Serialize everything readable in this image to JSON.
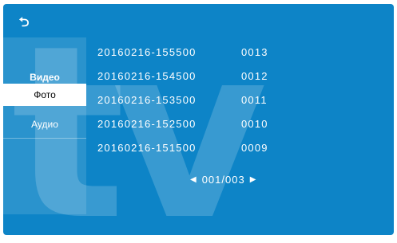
{
  "watermark": "tv",
  "back_icon": "back-arrow-icon",
  "sidebar": {
    "items": [
      {
        "label": "Видео",
        "selected": false
      },
      {
        "label": "Фото",
        "selected": true
      },
      {
        "label": "Аудио",
        "selected": false
      }
    ]
  },
  "files": [
    {
      "name": "20160216-155500",
      "number": "0013"
    },
    {
      "name": "20160216-154500",
      "number": "0012"
    },
    {
      "name": "20160216-153500",
      "number": "0011"
    },
    {
      "name": "20160216-152500",
      "number": "0010"
    },
    {
      "name": "20160216-151500",
      "number": "0009"
    }
  ],
  "pager": {
    "current": "001",
    "separator": "/",
    "total": "003"
  },
  "colors": {
    "background": "#0d84c7",
    "selected_item_bg": "#ffffff",
    "text": "#ffffff"
  }
}
